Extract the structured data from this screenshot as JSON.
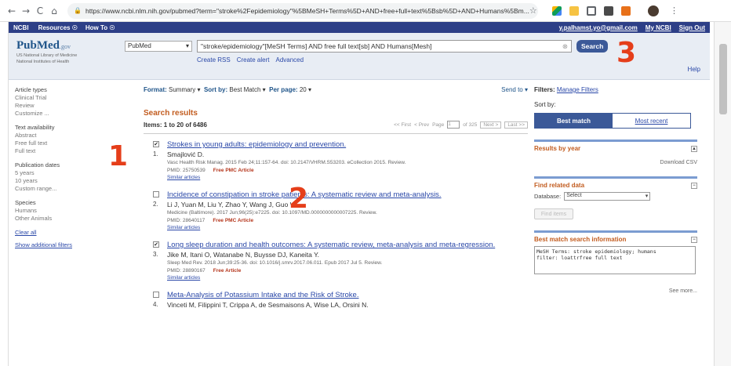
{
  "browser": {
    "url": "https://www.ncbi.nlm.nih.gov/pubmed?term=\"stroke%2Fepidemiology\"%5BMeSH+Terms%5D+AND+free+full+text%5Bsb%5D+AND+Humans%5Bm..."
  },
  "ncbi_bar": {
    "logo": "NCBI",
    "resources": "Resources ☉",
    "howto": "How To ☉",
    "user": "y.palhamst.yo@gmail.com",
    "my_ncbi": "My NCBI",
    "sign_out": "Sign Out"
  },
  "header": {
    "brand": "PubMed",
    "gov": ".gov",
    "sub1": "US National Library of Medicine",
    "sub2": "National Institutes of Health",
    "db": "PubMed",
    "query": "\"stroke/epidemiology\"[MeSH Terms] AND free full text[sb] AND Humans[Mesh]",
    "search_btn": "Search",
    "create_rss": "Create RSS",
    "create_alert": "Create alert",
    "advanced": "Advanced",
    "help": "Help"
  },
  "annotations": [
    "1",
    "2",
    "3"
  ],
  "filters": {
    "article_types_title": "Article types",
    "article_types": [
      "Clinical Trial",
      "Review",
      "Customize ..."
    ],
    "text_avail_title": "Text availability",
    "text_avail": [
      "Abstract",
      "Free full text",
      "Full text"
    ],
    "pub_dates_title": "Publication dates",
    "pub_dates": [
      "5 years",
      "10 years",
      "Custom range..."
    ],
    "species_title": "Species",
    "species": [
      "Humans",
      "Other Animals"
    ],
    "clear_all": "Clear all",
    "show_additional": "Show additional filters"
  },
  "toolbar": {
    "format_label": "Format:",
    "format_val": "Summary ▾",
    "sort_label": "Sort by:",
    "sort_val": "Best Match ▾",
    "perpage_label": "Per page:",
    "perpage_val": "20 ▾",
    "send_to": "Send to ▾"
  },
  "results": {
    "heading": "Search results",
    "items": "Items: 1 to 20 of 6486",
    "first": "<< First",
    "prev": "< Prev",
    "page_label": "Page",
    "page_val": "1",
    "of_pages": "of 325",
    "next": "Next >",
    "last": "Last >>",
    "list": [
      {
        "checked": true,
        "num": "1.",
        "title": "Strokes in young adults: epidemiology and prevention.",
        "authors": "Smajlović D.",
        "journal": "Vasc Health Risk Manag. 2015 Feb 24;11:157-64. doi: 10.2147/VHRM.S53203. eCollection 2015. Review.",
        "pmid": "PMID: 25750539",
        "free": "Free PMC Article",
        "similar": "Similar articles"
      },
      {
        "checked": false,
        "num": "2.",
        "title": "Incidence of constipation in stroke patients: A systematic review and meta-analysis.",
        "authors": "Li J, Yuan M, Liu Y, Zhao Y, Wang J, Guo W.",
        "journal": "Medicine (Baltimore). 2017 Jun;96(25):e7225. doi: 10.1097/MD.0000000000007225. Review.",
        "pmid": "PMID: 28640117",
        "free": "Free PMC Article",
        "similar": "Similar articles"
      },
      {
        "checked": true,
        "num": "3.",
        "title": "Long sleep duration and health outcomes: A systematic review, meta-analysis and meta-regression.",
        "authors": "Jike M, Itani O, Watanabe N, Buysse DJ, Kaneita Y.",
        "journal": "Sleep Med Rev. 2018 Jun;39:25-36. doi: 10.1016/j.smrv.2017.06.011. Epub 2017 Jul 5. Review.",
        "pmid": "PMID: 28890167",
        "free": "Free Article",
        "similar": "Similar articles"
      },
      {
        "checked": false,
        "num": "4.",
        "title": "Meta-Analysis of Potassium Intake and the Risk of Stroke.",
        "authors": "Vinceti M, Filippini T, Crippa A, de Sesmaisons A, Wise LA, Orsini N.",
        "journal": "",
        "pmid": "",
        "free": "",
        "similar": ""
      }
    ]
  },
  "sidebar": {
    "filters_label": "Filters:",
    "manage_filters": "Manage Filters",
    "sort_by": "Sort by:",
    "best_match": "Best match",
    "most_recent": "Most recent",
    "results_by_year": "Results by year",
    "download_csv": "Download CSV",
    "find_related": "Find related data",
    "database_label": "Database:",
    "database_val": "Select",
    "find_items": "Find items",
    "best_match_info": "Best match search information",
    "mesh_text": "MeSH Terms: stroke epidemiology; humans\nfilter: loattrfree full text",
    "see_more": "See more..."
  }
}
